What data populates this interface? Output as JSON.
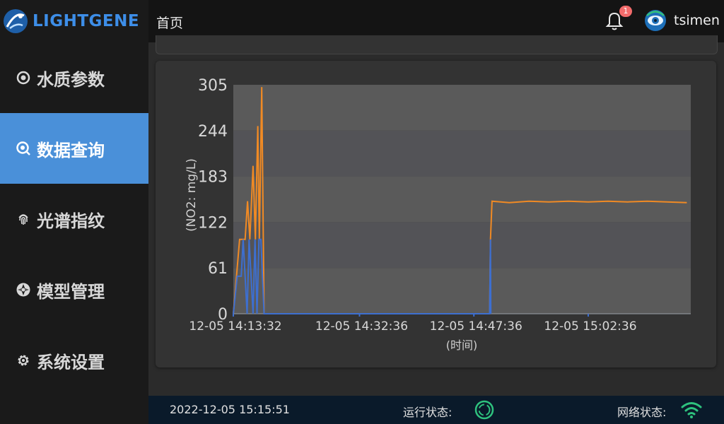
{
  "brand": {
    "name": "LIGHTGENE",
    "accent": "#3d8ee8"
  },
  "sidebar": {
    "items": [
      {
        "label": "水质参数",
        "icon": "water-quality-icon",
        "active": false
      },
      {
        "label": "数据查询",
        "icon": "search-data-icon",
        "active": true
      },
      {
        "label": "光谱指纹",
        "icon": "fingerprint-icon",
        "active": false
      },
      {
        "label": "模型管理",
        "icon": "model-aperture-icon",
        "active": false
      },
      {
        "label": "系统设置",
        "icon": "gear-icon",
        "active": false
      }
    ],
    "active_color": "#4a90d9"
  },
  "header": {
    "breadcrumb": "首页",
    "notification_count": "1",
    "username": "tsimen"
  },
  "chart_data": {
    "type": "line",
    "ylabel": "(NO2: mg/L)",
    "xlabel": "(时间)",
    "ylim": [
      0,
      305
    ],
    "y_ticks": [
      "305",
      "244",
      "183",
      "122",
      "61",
      "0"
    ],
    "x_ticks": [
      "12-05 14:13:32",
      "12-05 14:32:36",
      "12-05 14:47:36",
      "12-05 15:02:36"
    ],
    "grid": "horizontal bands",
    "series": [
      {
        "color": "#f08a24",
        "points": [
          [
            0,
            0
          ],
          [
            0.16,
            99
          ],
          [
            0.3,
            99
          ],
          [
            0.36,
            150
          ],
          [
            0.42,
            99
          ],
          [
            0.5,
            197
          ],
          [
            0.56,
            99
          ],
          [
            0.62,
            250
          ],
          [
            0.66,
            99
          ],
          [
            0.72,
            302
          ],
          [
            0.78,
            0
          ],
          [
            6.5,
            0
          ],
          [
            6.52,
            99
          ],
          [
            6.56,
            150
          ],
          [
            7.0,
            148
          ],
          [
            7.5,
            150
          ],
          [
            8.0,
            149
          ],
          [
            8.5,
            150
          ],
          [
            9.0,
            149
          ],
          [
            9.5,
            150
          ],
          [
            10.0,
            149
          ],
          [
            10.5,
            150
          ],
          [
            11.0,
            149
          ],
          [
            11.5,
            148
          ]
        ]
      },
      {
        "color": "#3d6fd0",
        "points": [
          [
            0,
            0
          ],
          [
            0.1,
            50
          ],
          [
            0.2,
            50
          ],
          [
            0.25,
            99
          ],
          [
            0.35,
            0
          ],
          [
            0.4,
            99
          ],
          [
            0.5,
            0
          ],
          [
            0.55,
            99
          ],
          [
            0.6,
            0
          ],
          [
            0.65,
            99
          ],
          [
            0.7,
            99
          ],
          [
            0.78,
            0
          ],
          [
            6.5,
            0
          ],
          [
            6.52,
            99
          ],
          [
            6.53,
            0
          ]
        ]
      }
    ]
  },
  "footer": {
    "datetime": "2022-12-05 15:15:51",
    "run_status_label": "运行状态:",
    "network_status_label": "网络状态:",
    "status_color": "#2ec27e"
  }
}
